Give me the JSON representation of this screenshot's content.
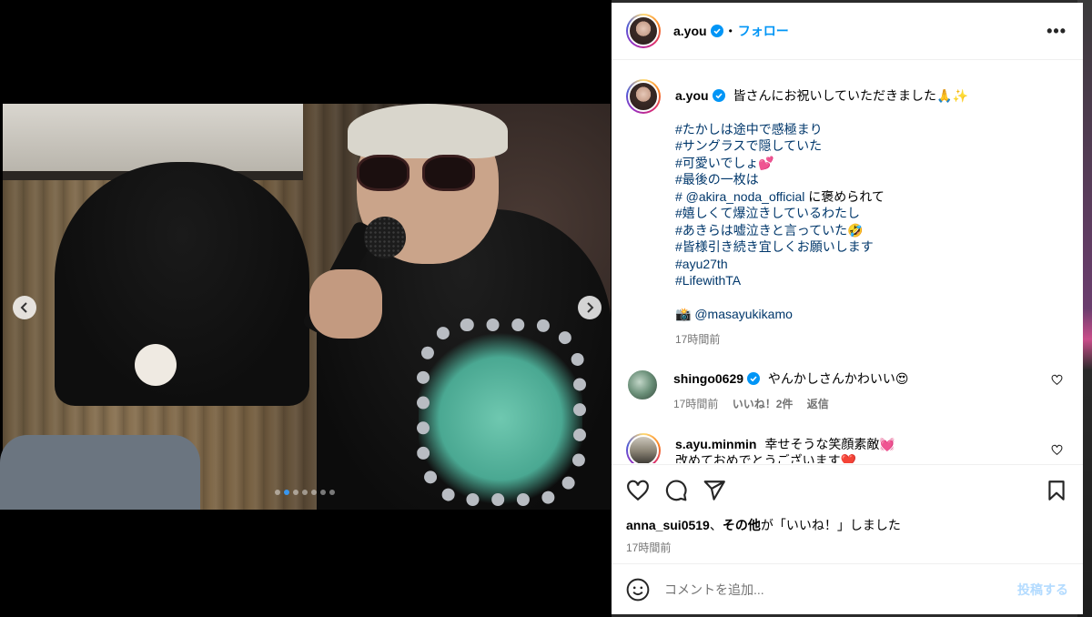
{
  "post": {
    "author": "a.you",
    "follow_label": "フォロー",
    "more_label": "•••",
    "separator": "•",
    "caption": {
      "first_line": "皆さんにお祝いしていただきました🙏✨",
      "hashtags": [
        {
          "text": "#たかしは途中で感極まり",
          "suffix": ""
        },
        {
          "text": "#サングラスで隠していた",
          "suffix": ""
        },
        {
          "text": "#可愛いでしょ💕",
          "suffix": ""
        },
        {
          "text": "#最後の一枚は",
          "suffix": ""
        },
        {
          "text": "# @akira_noda_official",
          "suffix": " に褒められて"
        },
        {
          "text": "#嬉しくて爆泣きしているわたし",
          "suffix": ""
        },
        {
          "text": "#あきらは嘘泣きと言っていた🤣",
          "suffix": ""
        },
        {
          "text": "#皆様引き続き宜しくお願いします",
          "suffix": ""
        },
        {
          "text": "#ayu27th",
          "suffix": ""
        },
        {
          "text": "#LifewithTA",
          "suffix": ""
        }
      ],
      "photo_credit": "📸 @masayukikamo",
      "time": "17時間前"
    },
    "comments": [
      {
        "user": "shingo0629",
        "text": "やんかしさんかわいい😍",
        "time": "17時間前",
        "likes": "いいね！2件",
        "reply": "返信",
        "verified": true
      },
      {
        "user": "s.ayu.minmin",
        "text": "幸せそうな笑顔素敵💓",
        "text2": "改めておめでとうございます❤️",
        "verified": false
      }
    ],
    "liked_by": {
      "user": "anna_sui0519",
      "middle": "、",
      "others": "その他",
      "suffix": "が「いいね！」しました"
    },
    "post_time": "17時間前",
    "comment_placeholder": "コメントを追加...",
    "post_button": "投稿する"
  },
  "carousel": {
    "total_slides": 7,
    "active_index": 1
  },
  "colors": {
    "link": "#00376b",
    "follow": "#0095f6",
    "verified": "#0095f6",
    "muted": "#737373",
    "active_dot": "#3897f0"
  }
}
